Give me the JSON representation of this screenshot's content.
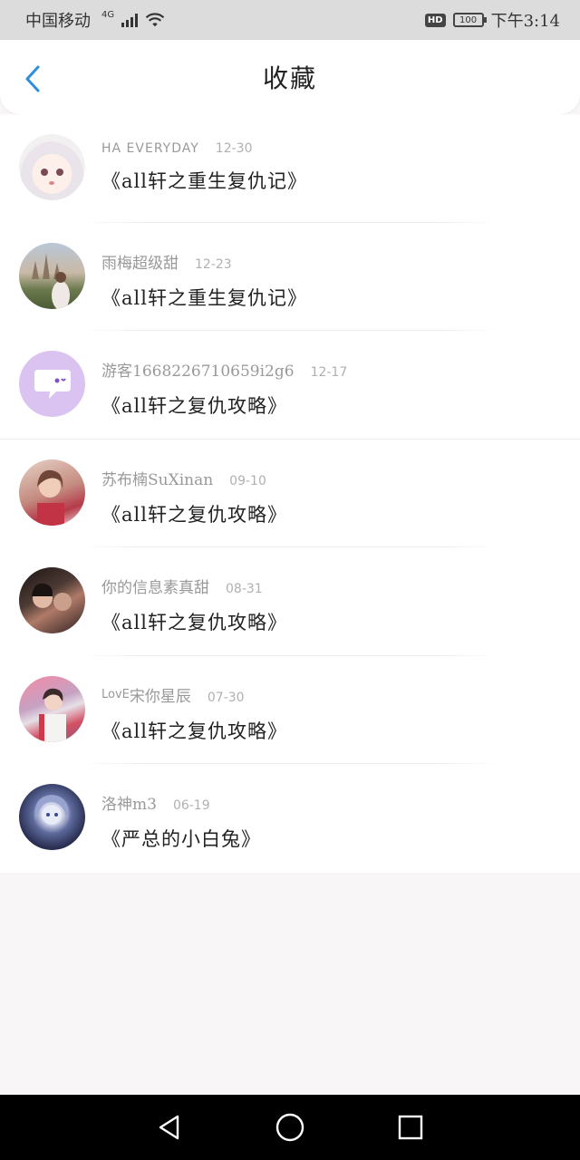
{
  "status_bar": {
    "carrier": "中国移动",
    "network": "4G",
    "battery": "100",
    "time": "下午3:14",
    "hd": "HD"
  },
  "header": {
    "title": "收藏",
    "back_icon": "chevron-left-icon",
    "accent_color": "#2a8fe0"
  },
  "favorites": [
    {
      "username": "HA EVERYDAY",
      "date": "12-30",
      "title": "《all轩之重生复仇记》"
    },
    {
      "username": "雨梅超级甜",
      "date": "12-23",
      "title": "《all轩之重生复仇记》"
    },
    {
      "username": "游客1668226710659i2g6",
      "date": "12-17",
      "title": "《all轩之复仇攻略》"
    },
    {
      "username": "苏布楠SuXinan",
      "date": "09-10",
      "title": "《all轩之复仇攻略》"
    },
    {
      "username": "你的信息素真甜",
      "date": "08-31",
      "title": "《all轩之复仇攻略》"
    },
    {
      "username_prefix": "LovE",
      "username": "宋你星辰",
      "date": "07-30",
      "title": "《all轩之复仇攻略》"
    },
    {
      "username": "洛神m3",
      "date": "06-19",
      "title": "《严总的小白兔》"
    }
  ],
  "nav_bar": {
    "back": "triangle-back-icon",
    "home": "circle-home-icon",
    "recents": "square-recents-icon"
  }
}
